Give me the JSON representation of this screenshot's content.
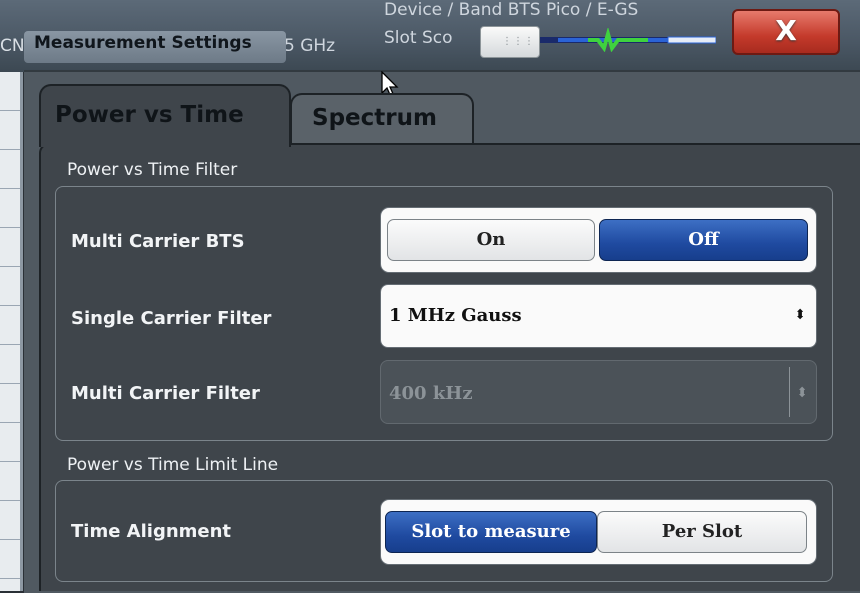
{
  "background": {
    "left_text": "CN",
    "freq_text": "5 GHz",
    "device_text": "Device / Band  BTS Pico / E-GS",
    "slot_text": "Slot Sco"
  },
  "dialog": {
    "title": "Measurement Settings",
    "close_label": "X",
    "tabs": [
      {
        "label": "Power vs Time",
        "active": true
      },
      {
        "label": "Spectrum",
        "active": false
      }
    ],
    "sections": {
      "filter": {
        "title": "Power vs Time Filter",
        "multi_carrier_bts": {
          "label": "Multi Carrier BTS",
          "on_label": "On",
          "off_label": "Off",
          "selected": "Off"
        },
        "single_carrier_filter": {
          "label": "Single Carrier Filter",
          "value": "1 MHz Gauss"
        },
        "multi_carrier_filter": {
          "label": "Multi Carrier Filter",
          "value": "400 kHz",
          "disabled": true
        }
      },
      "limit_line": {
        "title": "Power vs Time Limit Line",
        "time_alignment": {
          "label": "Time Alignment",
          "option_1": "Slot to measure",
          "option_2": "Per Slot",
          "selected": "Slot to measure"
        }
      }
    }
  },
  "colors": {
    "accent_selected": "#1f4aa0",
    "close_button": "#c43a2b",
    "panel": "#3f454b"
  },
  "icons": {
    "close": "close-icon",
    "dropdown": "updown-arrow-icon",
    "cursor": "mouse-pointer-icon",
    "grip": "slider-grip-icon"
  }
}
